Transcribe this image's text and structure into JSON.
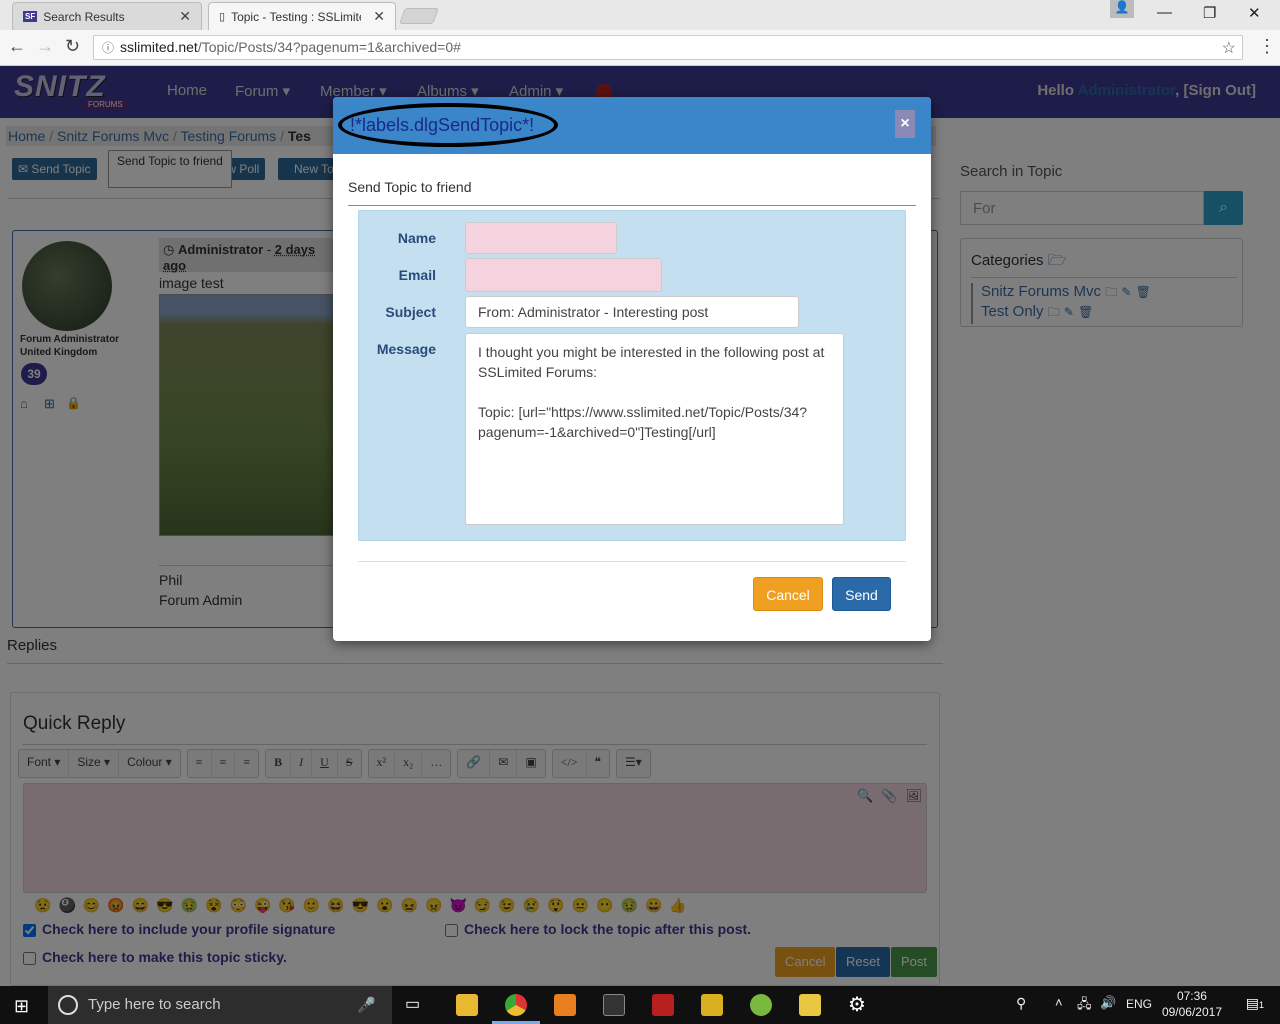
{
  "browser": {
    "tabs": [
      {
        "label": "Search Results",
        "favicon": "SF"
      },
      {
        "label": "Topic - Testing : SSLimite"
      }
    ],
    "url_host": "sslimited.net",
    "url_path": "/Topic/Posts/34?pagenum=1&archived=0#"
  },
  "nav": {
    "logo": "SNITZ",
    "logo_sub": "FORUMS",
    "items": [
      "Home",
      "Forum ▾",
      "Member ▾",
      "Albums ▾",
      "Admin ▾"
    ],
    "hello": "Hello",
    "user": "Administrator",
    "signout": ", [Sign Out]"
  },
  "breadcrumb": {
    "items": [
      "Home",
      "/",
      "Snitz Forums Mvc",
      "/",
      "Testing Forums",
      "/",
      "Tes"
    ]
  },
  "actions": {
    "send_topic": "✉ Send Topic",
    "new_poll": "New Poll",
    "new_topic": "New To",
    "tooltip": "Send Topic to friend"
  },
  "post": {
    "role": "Forum Administrator",
    "country": "United Kingdom",
    "post_count": "39",
    "author": "Administrator",
    "time": "2 days ago",
    "body": "image test",
    "sig_name": "Phil",
    "sig_role": "Forum Admin"
  },
  "replies_label": "Replies",
  "quick_reply": {
    "title": "Quick Reply",
    "toolbar": {
      "font": "Font ▾",
      "size": "Size ▾",
      "colour": "Colour ▾"
    },
    "signature": "Check here to include your profile signature",
    "lock": "Check here to lock the topic after this post.",
    "sticky": "Check here to make this topic sticky.",
    "cancel": "Cancel",
    "reset": "Reset",
    "post": "Post"
  },
  "sidebar": {
    "search_label": "Search in Topic",
    "search_placeholder": "For",
    "categories_title": "Categories",
    "categories": [
      "Snitz Forums Mvc",
      "Test Only"
    ]
  },
  "modal": {
    "title": "!*labels.dlgSendTopic*!",
    "close": "×",
    "subtitle": "Send Topic to friend",
    "name_label": "Name",
    "email_label": "Email",
    "subject_label": "Subject",
    "message_label": "Message",
    "subject_value": "From: Administrator - Interesting post",
    "message_value": "I thought you might be interested in the following post at SSLimited Forums:\n\nTopic: [url=\"https://www.sslimited.net/Topic/Posts/34?pagenum=-1&archived=0\"]Testing[/url]",
    "cancel": "Cancel",
    "send": "Send"
  },
  "taskbar": {
    "search_placeholder": "Type here to search",
    "lang": "ENG",
    "time": "07:36",
    "date": "09/06/2017",
    "notif": "1"
  }
}
